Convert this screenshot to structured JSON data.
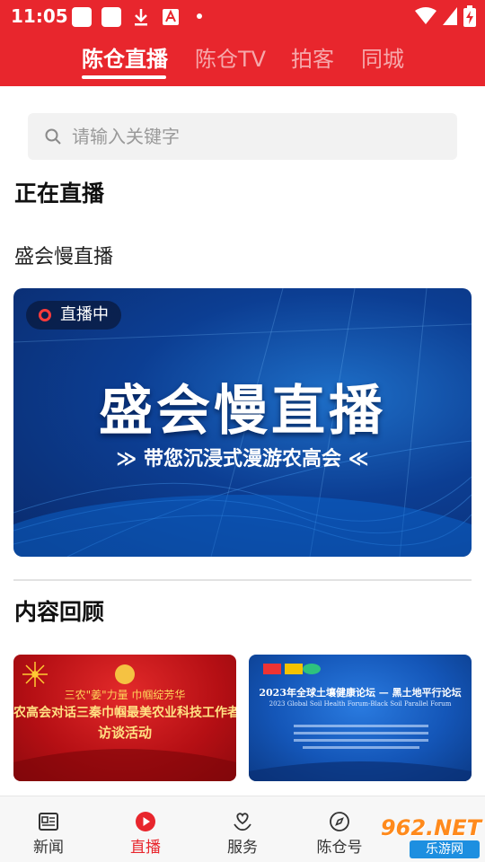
{
  "status_bar": {
    "time": "11:05"
  },
  "top_tabs": [
    {
      "label": "陈仓直播",
      "active": true
    },
    {
      "label": "陈仓TV",
      "active": false
    },
    {
      "label": "拍客",
      "active": false
    },
    {
      "label": "同城",
      "active": false
    }
  ],
  "search": {
    "placeholder": "请输入关键字"
  },
  "live_section": {
    "title": "正在直播",
    "subtitle": "盛会慢直播",
    "badge": "直播中",
    "banner_title": "盛会慢直播",
    "banner_subtitle": "≫  带您沉浸式漫游农高会  ≪"
  },
  "review_section": {
    "title": "内容回顾",
    "cards": [
      {
        "line1": "三农\"姜\"力量  巾帼绽芳华",
        "line2": "农高会对话三秦巾帼最美农业科技工作者",
        "line3": "访谈活动"
      },
      {
        "line1": "2023年全球土壤健康论坛 — 黑土地平行论坛",
        "line2": "2023 Global Soil Health Forum-Black Soil Parallel Forum"
      }
    ]
  },
  "bottom_nav": [
    {
      "label": "新闻",
      "icon": "news-icon",
      "active": false
    },
    {
      "label": "直播",
      "icon": "play-icon",
      "active": true
    },
    {
      "label": "服务",
      "icon": "service-icon",
      "active": false
    },
    {
      "label": "陈仓号",
      "icon": "compass-icon",
      "active": false
    }
  ],
  "watermark": {
    "text": "962.NET",
    "sub": "乐游网"
  },
  "colors": {
    "brand_red": "#e8262d",
    "banner_blue": "#0c3e93"
  }
}
